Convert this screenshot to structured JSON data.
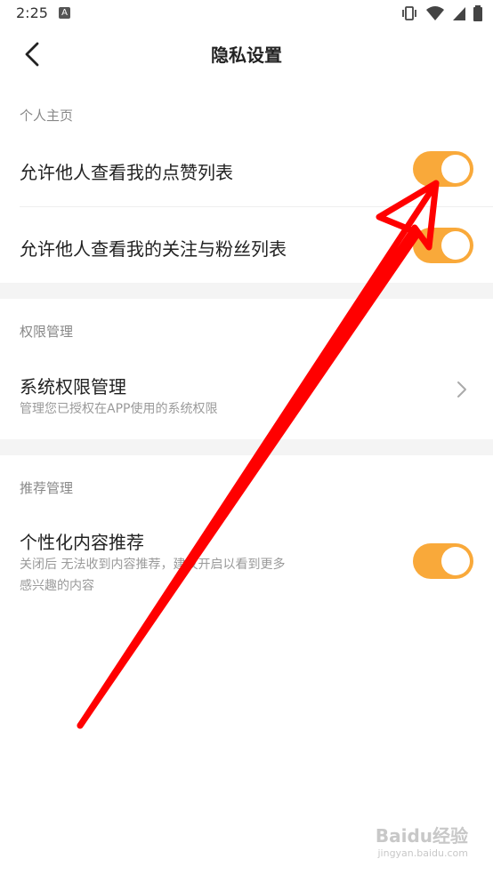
{
  "status": {
    "time": "2:25",
    "a_icon": "A"
  },
  "header": {
    "title": "隐私设置"
  },
  "sections": {
    "profile": {
      "label": "个人主页",
      "items": [
        {
          "title": "允许他人查看我的点赞列表",
          "enabled": true
        },
        {
          "title": "允许他人查看我的关注与粉丝列表",
          "enabled": true
        }
      ]
    },
    "permission": {
      "label": "权限管理",
      "item": {
        "title": "系统权限管理",
        "subtitle": "管理您已授权在APP使用的系统权限"
      }
    },
    "recommend": {
      "label": "推荐管理",
      "item": {
        "title": "个性化内容推荐",
        "subtitle_line1": "关闭后 无法收到内容推荐，建议开启以看到更多",
        "subtitle_line2": "感兴趣的内容",
        "enabled": true
      }
    }
  },
  "watermark": {
    "brand": "Baidu经验",
    "url": "jingyan.baidu.com"
  },
  "colors": {
    "toggle_on": "#f9a93a",
    "annotation_arrow": "#ff0000"
  }
}
